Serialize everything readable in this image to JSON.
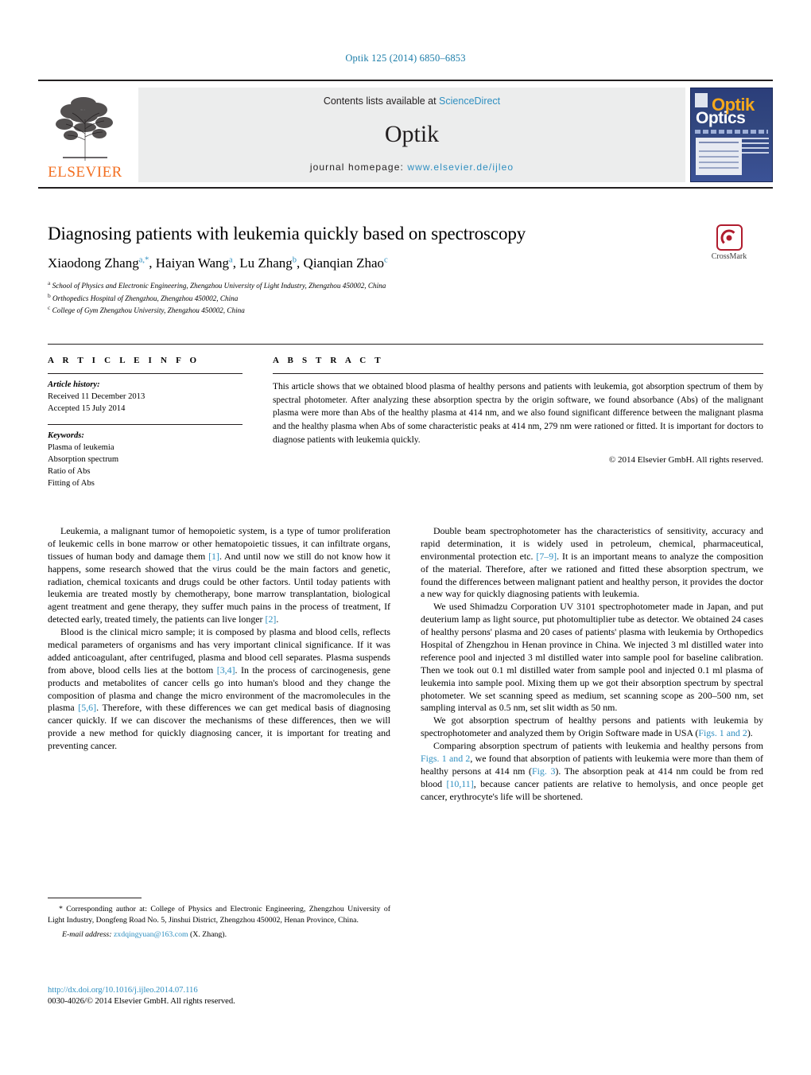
{
  "running_head": "Optik 125 (2014) 6850–6853",
  "masthead": {
    "publisher": "ELSEVIER",
    "contents_prefix": "Contents lists available at ",
    "contents_link": "ScienceDirect",
    "journal_title": "Optik",
    "homepage_prefix": "journal homepage: ",
    "homepage_link": "www.elsevier.de/ijleo",
    "cover": {
      "line1": "Optik",
      "line2": "Optics"
    }
  },
  "article": {
    "title": "Diagnosing patients with leukemia quickly based on spectroscopy",
    "authors_html": "Xiaodong Zhang<sup>a,</sup><sup class=\"star\">*</sup>, Haiyan Wang<sup>a</sup>, Lu Zhang<sup>b</sup>, Qianqian Zhao<sup>c</sup>",
    "affiliations": [
      {
        "mark": "a",
        "text": "School of Physics and Electronic Engineering, Zhengzhou University of Light Industry, Zhengzhou 450002, China"
      },
      {
        "mark": "b",
        "text": "Orthopedics Hospital of Zhengzhou, Zhengzhou 450002, China"
      },
      {
        "mark": "c",
        "text": "College of Gym Zhengzhou University, Zhengzhou 450002, China"
      }
    ],
    "crossmark_label": "CrossMark"
  },
  "info": {
    "heading": "A R T I C L E   I N F O",
    "history_label": "Article history:",
    "history": [
      "Received 11 December 2013",
      "Accepted 15 July 2014"
    ],
    "keywords_label": "Keywords:",
    "keywords": [
      "Plasma of leukemia",
      "Absorption spectrum",
      "Ratio of Abs",
      "Fitting of Abs"
    ]
  },
  "abstract": {
    "heading": "A B S T R A C T",
    "text": "This article shows that we obtained blood plasma of healthy persons and patients with leukemia, got absorption spectrum of them by spectral photometer. After analyzing these absorption spectra by the origin software, we found absorbance (Abs) of the malignant plasma were more than Abs of the healthy plasma at 414 nm, and we also found significant difference between the malignant plasma and the healthy plasma when Abs of some characteristic peaks at 414 nm, 279 nm were rationed or fitted. It is important for doctors to diagnose patients with leukemia quickly.",
    "copyright": "© 2014 Elsevier GmbH. All rights reserved."
  },
  "body": {
    "left": [
      {
        "parts": [
          {
            "t": "Leukemia, a malignant tumor of hemopoietic system, is a type of tumor proliferation of leukemic cells in bone marrow or other hematopoietic tissues, it can infiltrate organs, tissues of human body and damage them "
          },
          {
            "t": "[1]",
            "ref": true
          },
          {
            "t": ". And until now we still do not know how it happens, some research showed that the virus could be the main factors and genetic, radiation, chemical toxicants and drugs could be other factors. Until today patients with leukemia are treated mostly by chemotherapy, bone marrow transplantation, biological agent treatment and gene therapy, they suffer much pains in the process of treatment, If detected early, treated timely, the patients can live longer "
          },
          {
            "t": "[2]",
            "ref": true
          },
          {
            "t": "."
          }
        ]
      },
      {
        "parts": [
          {
            "t": "Blood is the clinical micro sample; it is composed by plasma and blood cells, reflects medical parameters of organisms and has very important clinical significance. If it was added anticoagulant, after centrifuged, plasma and blood cell separates. Plasma suspends from above, blood cells lies at the bottom "
          },
          {
            "t": "[3,4]",
            "ref": true
          },
          {
            "t": ". In the process of carcinogenesis, gene products and metabolites of cancer cells go into human's blood and they change the composition of plasma and change the micro environment of the macromolecules in the plasma "
          },
          {
            "t": "[5,6]",
            "ref": true
          },
          {
            "t": ". Therefore, with these differences we can get medical basis of diagnosing cancer quickly. If we can discover the mechanisms of these differences, then we will provide a new method for quickly diagnosing cancer, it is important for treating and preventing cancer."
          }
        ]
      }
    ],
    "right": [
      {
        "parts": [
          {
            "t": "Double beam spectrophotometer has the characteristics of sensitivity, accuracy and rapid determination, it is widely used in petroleum, chemical, pharmaceutical, environmental protection etc. "
          },
          {
            "t": "[7–9]",
            "ref": true
          },
          {
            "t": ". It is an important means to analyze the composition of the material. Therefore, after we rationed and fitted these absorption spectrum, we found the differences between malignant patient and healthy person, it provides the doctor a new way for quickly diagnosing patients with leukemia."
          }
        ]
      },
      {
        "parts": [
          {
            "t": "We used Shimadzu Corporation UV 3101 spectrophotometer made in Japan, and put deuterium lamp as light source, put photomultiplier tube as detector. We obtained 24 cases of healthy persons' plasma and 20 cases of patients' plasma with leukemia by Orthopedics Hospital of Zhengzhou in Henan province in China. We injected 3 ml distilled water into reference pool and injected 3 ml distilled water into sample pool for baseline calibration. Then we took out 0.1 ml distilled water from sample pool and injected 0.1 ml plasma of leukemia into sample pool. Mixing them up we got their absorption spectrum by spectral photometer. We set scanning speed as medium, set scanning scope as 200–500 nm, set sampling interval as 0.5 nm, set slit width as 50 nm."
          }
        ]
      },
      {
        "parts": [
          {
            "t": "We got absorption spectrum of healthy persons and patients with leukemia by spectrophotometer and analyzed them by Origin Software made in USA ("
          },
          {
            "t": "Figs. 1 and 2",
            "fig": true
          },
          {
            "t": ")."
          }
        ]
      },
      {
        "parts": [
          {
            "t": "Comparing absorption spectrum of patients with leukemia and healthy persons from "
          },
          {
            "t": "Figs. 1 and 2",
            "fig": true
          },
          {
            "t": ", we found that absorption of patients with leukemia were more than them of healthy persons at 414 nm ("
          },
          {
            "t": "Fig. 3",
            "fig": true
          },
          {
            "t": "). The absorption peak at 414 nm could be from red blood "
          },
          {
            "t": "[10,11]",
            "ref": true
          },
          {
            "t": ", because cancer patients are relative to hemolysis, and once people get cancer, erythrocyte's life will be shortened."
          }
        ]
      }
    ]
  },
  "footnote": {
    "corresponding": "* Corresponding author at: College of Physics and Electronic Engineering, Zhengzhou University of Light Industry, Dongfeng Road No. 5, Jinshui District, Zhengzhou 450002, Henan Province, China.",
    "email_label": "E-mail address:",
    "email": "zxdqingyuan@163.com",
    "email_suffix": "(X. Zhang)."
  },
  "doi": {
    "link": "http://dx.doi.org/10.1016/j.ijleo.2014.07.116",
    "issn_line": "0030-4026/© 2014 Elsevier GmbH. All rights reserved."
  },
  "colors": {
    "link": "#2f8fc0",
    "running_head": "#1a7ca8",
    "elsevier_orange": "#f36f21",
    "crossmark_red": "#b01c2e"
  }
}
